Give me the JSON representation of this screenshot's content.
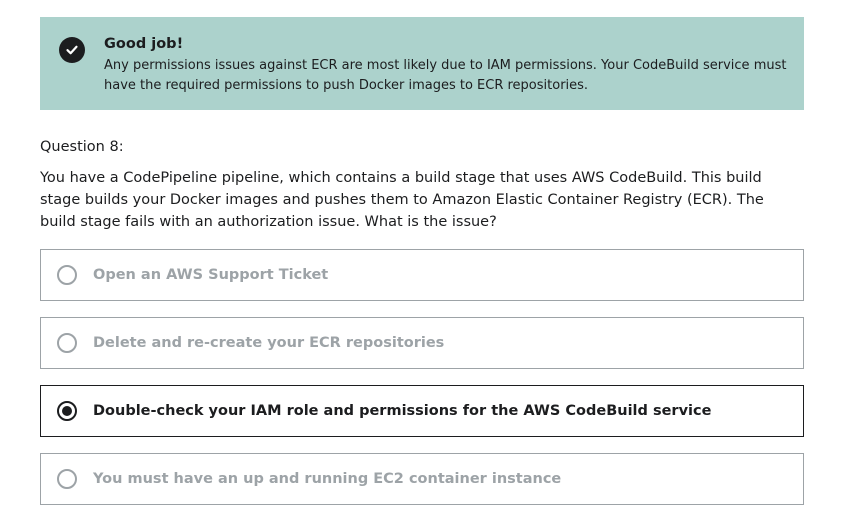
{
  "feedback": {
    "icon": "check-circle-icon",
    "title": "Good job!",
    "body": "Any permissions issues against ECR are most likely due to IAM permissions. Your CodeBuild service must have the required permissions to push Docker images to ECR repositories.",
    "background_color": "#acd2cc"
  },
  "question": {
    "number": "Question 8:",
    "text": "You have a CodePipeline pipeline, which contains a build stage that uses AWS CodeBuild. This build stage builds your Docker images and pushes them to Amazon Elastic Container Registry (ECR). The build stage fails with an authorization issue. What is the issue?"
  },
  "answers": [
    {
      "label": "Open an AWS Support Ticket",
      "selected": false
    },
    {
      "label": "Delete and re-create your ECR repositories",
      "selected": false
    },
    {
      "label": "Double-check your IAM role and permissions for the AWS CodeBuild service",
      "selected": true
    },
    {
      "label": "You must have an up and running EC2 container instance",
      "selected": false
    }
  ],
  "colors": {
    "text": "#1c1d1f",
    "muted": "#9da3a7"
  }
}
